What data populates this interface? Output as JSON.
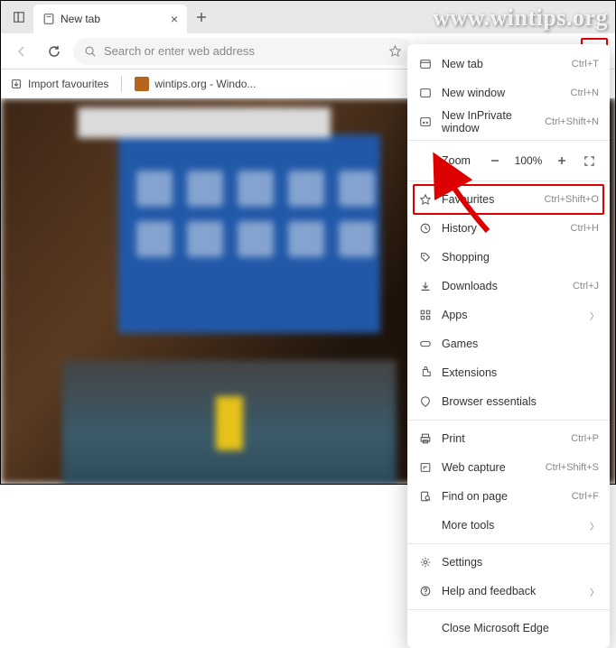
{
  "watermark": "www.wintips.org",
  "tab": {
    "title": "New tab"
  },
  "address": {
    "placeholder": "Search or enter web address"
  },
  "bookmarks": {
    "import_label": "Import favourites",
    "wintips_label": "wintips.org - Windo..."
  },
  "menu": {
    "new_tab": "New tab",
    "new_tab_sc": "Ctrl+T",
    "new_window": "New window",
    "new_window_sc": "Ctrl+N",
    "inprivate": "New InPrivate window",
    "inprivate_sc": "Ctrl+Shift+N",
    "zoom_label": "Zoom",
    "zoom_value": "100%",
    "favourites": "Favourites",
    "favourites_sc": "Ctrl+Shift+O",
    "history": "History",
    "history_sc": "Ctrl+H",
    "shopping": "Shopping",
    "downloads": "Downloads",
    "downloads_sc": "Ctrl+J",
    "apps": "Apps",
    "games": "Games",
    "extensions": "Extensions",
    "essentials": "Browser essentials",
    "print": "Print",
    "print_sc": "Ctrl+P",
    "webcapture": "Web capture",
    "webcapture_sc": "Ctrl+Shift+S",
    "find": "Find on page",
    "find_sc": "Ctrl+F",
    "more_tools": "More tools",
    "settings": "Settings",
    "help": "Help and feedback",
    "close_edge": "Close Microsoft Edge"
  }
}
